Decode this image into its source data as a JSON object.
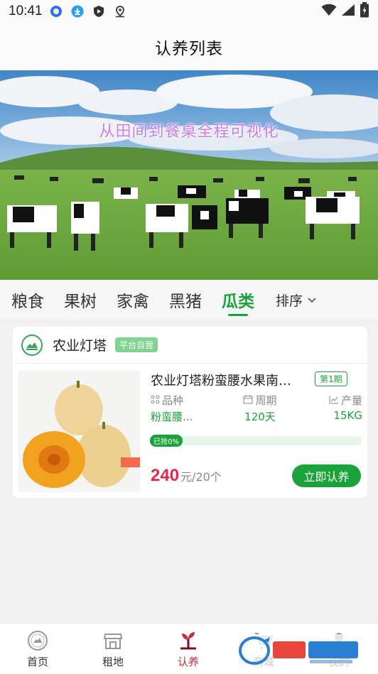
{
  "status_bar": {
    "time": "10:41",
    "left_icons": [
      "chat-bubble-icon",
      "download-icon",
      "shield-icon",
      "location-pin-icon"
    ],
    "right_icons": [
      "wifi-icon",
      "signal-icon",
      "battery-icon"
    ]
  },
  "header": {
    "title": "认养列表"
  },
  "banner": {
    "caption": "从田间到餐桌全程可视化"
  },
  "tabs": {
    "items": [
      "粮食",
      "果树",
      "家禽",
      "黑猪",
      "瓜类"
    ],
    "active_index": 4,
    "sort_label": "排序"
  },
  "product": {
    "store_name": "农业灯塔",
    "store_badge": "平台自营",
    "title": "农业灯塔粉蛮腰水果南…",
    "period_badge": "第1期",
    "meta": {
      "variety_label": "品种",
      "variety_value": "粉蛮腰...",
      "cycle_label": "周期",
      "cycle_value": "120天",
      "yield_label": "产量",
      "yield_value": "15KG"
    },
    "progress_label": "已抢0%",
    "progress_fraction": 0,
    "price": "240",
    "price_unit": "元/20个",
    "buy_label": "立即认养"
  },
  "bottom_nav": {
    "items": [
      {
        "label": "首页",
        "icon": "home-logo-icon"
      },
      {
        "label": "租地",
        "icon": "store-icon"
      },
      {
        "label": "认养",
        "icon": "sprout-icon"
      },
      {
        "label": "商城",
        "icon": "cart-icon"
      },
      {
        "label": "我的",
        "icon": "user-icon"
      }
    ],
    "active_index": 2
  },
  "colors": {
    "accent_green": "#1aa33a",
    "price_red": "#e8264a",
    "active_nav_red": "#d2283c"
  }
}
